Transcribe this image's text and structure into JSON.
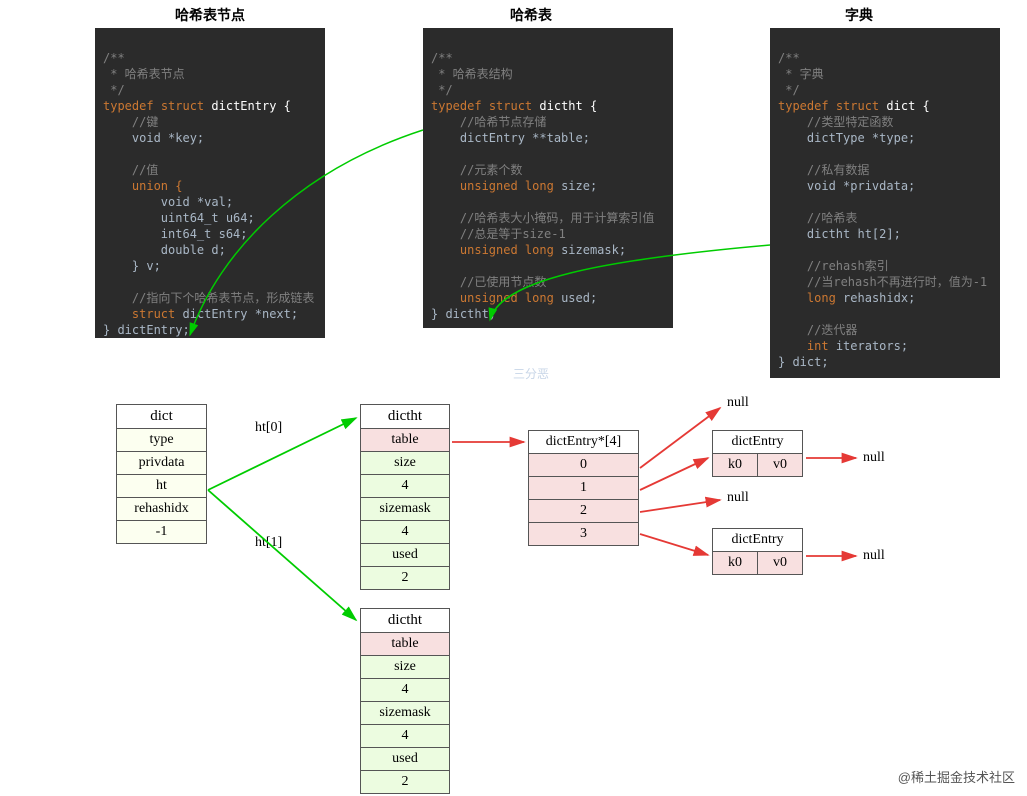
{
  "titles": {
    "dictEntry": "哈希表节点",
    "dictht": "哈希表",
    "dict": "字典"
  },
  "code": {
    "dictEntry": {
      "c1": "/**",
      "c2": " * 哈希表节点",
      "c3": " */",
      "l_typedef": "typedef",
      "l_struct": "struct",
      "l_name": "dictEntry {",
      "c_key": "//键",
      "key": "void *key;",
      "c_val": "//值",
      "union": "union {",
      "u1": "void *val;",
      "u2": "uint64_t u64;",
      "u3": "int64_t s64;",
      "u4": "double d;",
      "u_end": "} v;",
      "c_next": "//指向下个哈希表节点，形成链表",
      "next": "struct dictEntry *next;",
      "end": "} dictEntry;"
    },
    "dictht": {
      "c1": "/**",
      "c2": " * 哈希表结构",
      "c3": " */",
      "l_typedef": "typedef",
      "l_struct": "struct",
      "l_name": "dictht {",
      "c_table": "//哈希节点存储",
      "table": "dictEntry **table;",
      "c_size": "//元素个数",
      "size": "unsigned long size;",
      "c_mask1": "//哈希表大小掩码，用于计算索引值",
      "c_mask2": "//总是等于size-1",
      "mask": "unsigned long sizemask;",
      "c_used": "//已使用节点数",
      "used": "unsigned long used;",
      "end": "} dictht;"
    },
    "dict": {
      "c1": "/**",
      "c2": " * 字典",
      "c3": " */",
      "l_typedef": "typedef",
      "l_struct": "struct",
      "l_name": "dict {",
      "c_type": "//类型特定函数",
      "type": "dictType *type;",
      "c_priv": "//私有数据",
      "priv": "void *privdata;",
      "c_ht": "//哈希表",
      "ht": "dictht ht[2];",
      "c_rh1": "//rehash索引",
      "c_rh2": "//当rehash不再进行时，值为-1",
      "rh": "long rehashidx;",
      "c_it": "//迭代器",
      "it": "int iterators;",
      "end": "} dict;"
    }
  },
  "diagram": {
    "dict": {
      "rows": [
        "dict",
        "type",
        "privdata",
        "ht",
        "rehashidx",
        "-1"
      ]
    },
    "dictht0": {
      "rows": [
        "dictht",
        "table",
        "size",
        "4",
        "sizemask",
        "4",
        "used",
        "2"
      ]
    },
    "dictht1": {
      "rows": [
        "dictht",
        "table",
        "size",
        "4",
        "sizemask",
        "4",
        "used",
        "2"
      ]
    },
    "array": {
      "header": "dictEntry*[4]",
      "rows": [
        "0",
        "1",
        "2",
        "3"
      ]
    },
    "entry1": {
      "header": "dictEntry",
      "k": "k0",
      "v": "v0"
    },
    "entry2": {
      "header": "dictEntry",
      "k": "k0",
      "v": "v0"
    },
    "nulls": {
      "n0": "null",
      "n1": "null",
      "n2": "null",
      "n3": "null"
    },
    "edges": {
      "ht0": "ht[0]",
      "ht1": "ht[1]"
    }
  },
  "watermarks": {
    "sanfen": "三分恶",
    "juejin": "@稀土掘金技术社区"
  }
}
